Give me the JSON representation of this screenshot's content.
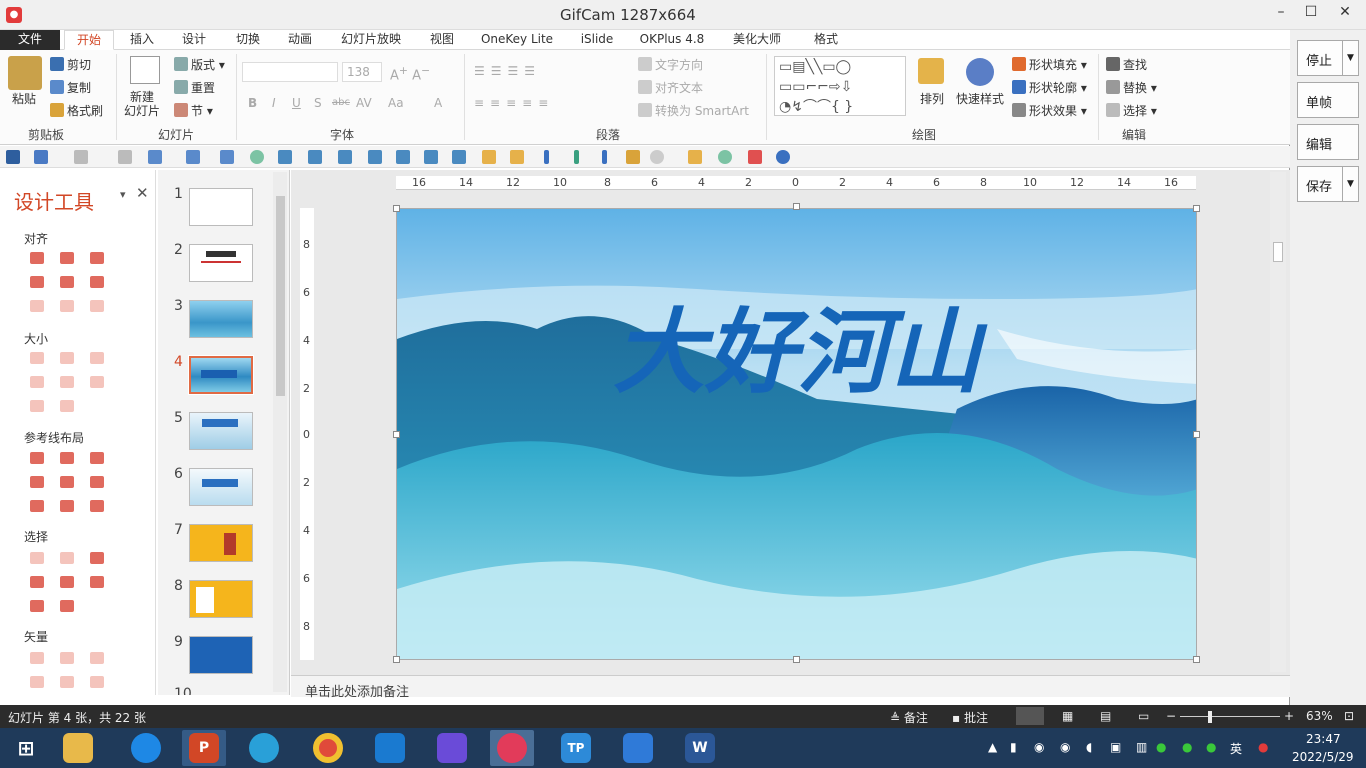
{
  "window": {
    "title": "GifCam 1287x664",
    "app_badge": "●",
    "min": "–",
    "max": "☐",
    "close": "✕"
  },
  "tabs": [
    "文件",
    "开始",
    "插入",
    "设计",
    "切换",
    "动画",
    "幻灯片放映",
    "视图",
    "OneKey Lite",
    "iSlide",
    "OKPlus 4.8",
    "美化大师",
    "格式"
  ],
  "ribbon": {
    "clipboard": {
      "paste": "粘贴",
      "cut": "剪切",
      "copy": "复制",
      "format_painter": "格式刷",
      "label": "剪贴板"
    },
    "slides": {
      "new_slide": "新建\n幻灯片",
      "layout": "版式",
      "reset": "重置",
      "section": "节",
      "label": "幻灯片"
    },
    "font": {
      "size": "138",
      "label": "字体",
      "bold": "B",
      "italic": "I",
      "underline": "U",
      "shadow": "S",
      "strike": "abc",
      "spacing": "AV",
      "case": "Aa",
      "color": "A"
    },
    "paragraph": {
      "text_direction": "文字方向",
      "align_text": "对齐文本",
      "smartart": "转换为 SmartArt",
      "label": "段落"
    },
    "drawing": {
      "arrange": "排列",
      "quick_styles": "快速样式",
      "shape_fill": "形状填充",
      "shape_outline": "形状轮廓",
      "shape_effects": "形状效果",
      "label": "绘图"
    },
    "editing": {
      "find": "查找",
      "replace": "替换",
      "select": "选择",
      "label": "编辑"
    }
  },
  "taskpane": {
    "title": "设计工具",
    "sections": [
      "对齐",
      "大小",
      "参考线布局",
      "选择",
      "矢量"
    ]
  },
  "thumbnails": {
    "numbers": [
      "1",
      "2",
      "3",
      "4",
      "5",
      "6",
      "7",
      "8",
      "9",
      "10"
    ],
    "active": "4"
  },
  "ruler": {
    "h": [
      "16",
      "14",
      "12",
      "10",
      "8",
      "6",
      "4",
      "2",
      "0",
      "2",
      "4",
      "6",
      "8",
      "10",
      "12",
      "14",
      "16"
    ],
    "v": [
      "8",
      "6",
      "4",
      "2",
      "0",
      "2",
      "4",
      "6",
      "8"
    ]
  },
  "slide": {
    "title_art": "大好河山"
  },
  "notes": {
    "placeholder": "单击此处添加备注"
  },
  "gifcam": {
    "stop": "停止",
    "frame": "单帧",
    "edit": "编辑",
    "save": "保存",
    "dropdown": "▼"
  },
  "statusbar": {
    "slide_info": "幻灯片 第 4 张，共 22 张",
    "notes": "备注",
    "comments": "批注",
    "zoom": "63%",
    "minus": "−",
    "plus": "+"
  },
  "taskbar": {
    "time": "23:47",
    "date": "2022/5/29",
    "ime": "英",
    "app_letters": {
      "ppt": "P",
      "tp": "TP",
      "word": "W"
    }
  },
  "colors": {
    "accent": "#d24726",
    "taskbar": "#1f3a5a",
    "statusbar": "#2c2c2c"
  }
}
